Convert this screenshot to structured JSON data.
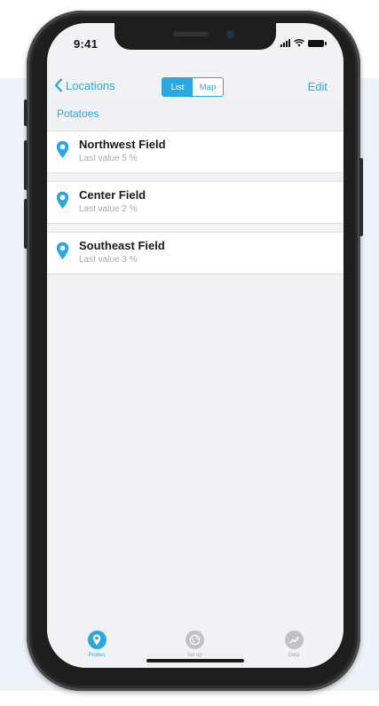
{
  "status_bar": {
    "time": "9:41"
  },
  "nav": {
    "back_label": "Locations",
    "segments": [
      "List",
      "Map"
    ],
    "edit_label": "Edit"
  },
  "section": {
    "title": "Potatoes"
  },
  "locations": [
    {
      "name": "Northwest Field",
      "subtitle": "Last value 5 %"
    },
    {
      "name": "Center Field",
      "subtitle": "Last value 2 %"
    },
    {
      "name": "Southeast Field",
      "subtitle": "Last value 3 %"
    }
  ],
  "tabs": [
    {
      "label": "Probes",
      "icon": "location-pin-icon",
      "active": true
    },
    {
      "label": "Set up",
      "icon": "globe-icon",
      "active": false
    },
    {
      "label": "Data",
      "icon": "chart-icon",
      "active": false
    }
  ],
  "colors": {
    "accent": "#2aa7e0",
    "inactive": "#bfc1c5"
  }
}
